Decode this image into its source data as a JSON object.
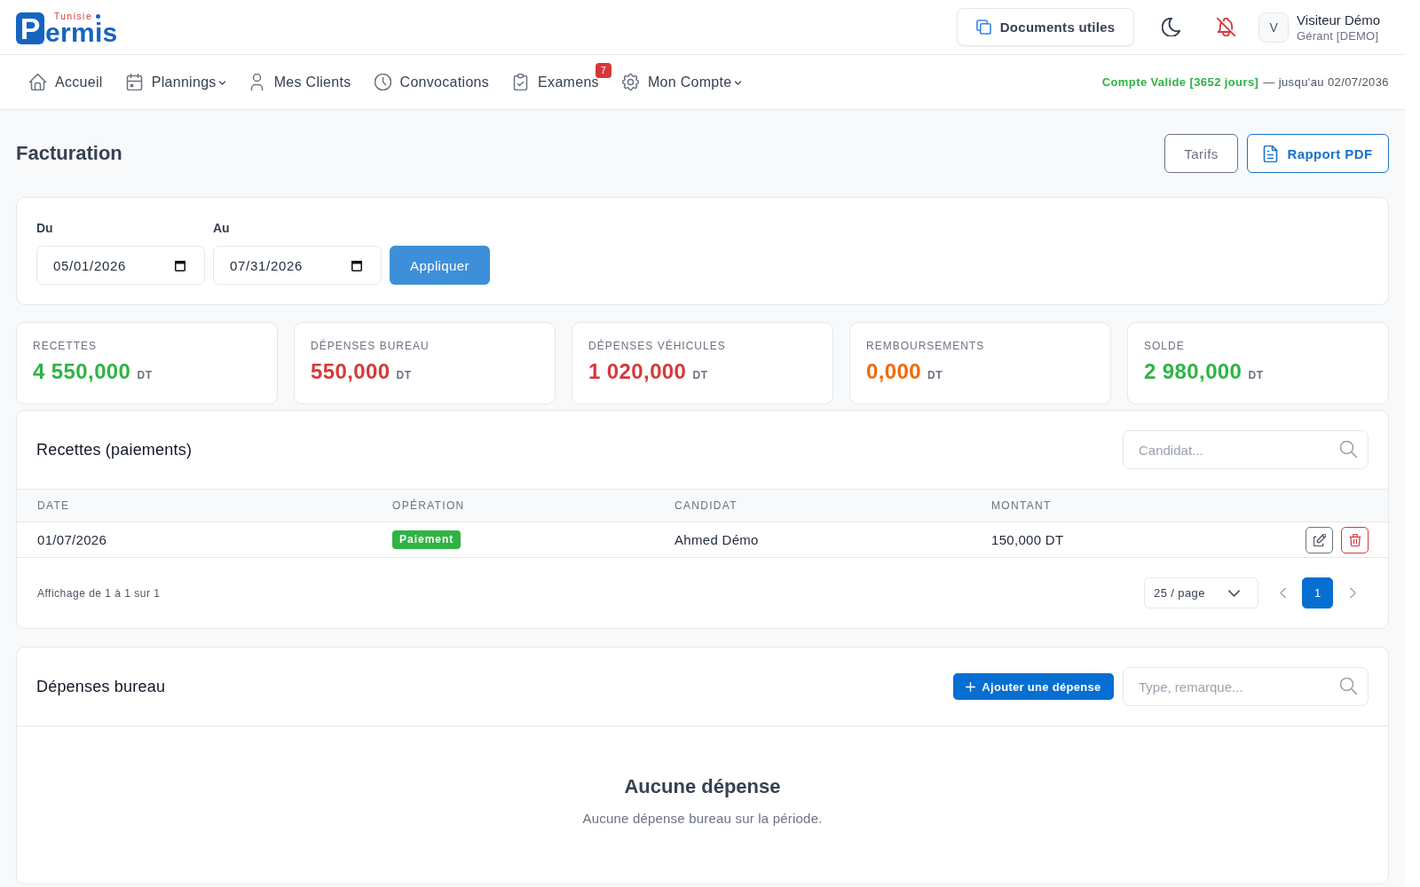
{
  "header": {
    "logo": {
      "tagline": "Tunisie",
      "letter": "P",
      "word": "ermis"
    },
    "documents_button": "Documents utiles",
    "notifications": {
      "muted": true
    },
    "user": {
      "initial": "V",
      "name": "Visiteur Démo",
      "role": "Gérant [DEMO]"
    }
  },
  "nav": {
    "items": [
      {
        "label": "Accueil",
        "dropdown": false
      },
      {
        "label": "Plannings",
        "dropdown": true
      },
      {
        "label": "Mes Clients",
        "dropdown": false
      },
      {
        "label": "Convocations",
        "dropdown": false
      },
      {
        "label": "Examens",
        "dropdown": false,
        "badge": "7"
      },
      {
        "label": "Mon Compte",
        "dropdown": true
      }
    ],
    "account": {
      "valid": true,
      "status": "Compte Valide [3652 jours]",
      "expiry": "— jusqu'au 02/07/2036"
    }
  },
  "page": {
    "title": "Facturation",
    "buttons": [
      {
        "label": "Tarifs",
        "kind": "secondary"
      },
      {
        "label": "Rapport PDF",
        "kind": "primary"
      }
    ]
  },
  "filter": {
    "fields": [
      {
        "label": "Du",
        "value": "05/01/2026"
      },
      {
        "label": "Au",
        "value": "07/31/2026"
      }
    ],
    "apply_button": "Appliquer"
  },
  "stats": [
    {
      "label": "RECETTES",
      "value": "4 550,000",
      "unit": "DT",
      "color": "#2fb344"
    },
    {
      "label": "DÉPENSES BUREAU",
      "value": "550,000",
      "unit": "DT",
      "color": "#d63939"
    },
    {
      "label": "DÉPENSES VÉHICULES",
      "value": "1 020,000",
      "unit": "DT",
      "color": "#d63939"
    },
    {
      "label": "REMBOURSEMENTS",
      "value": "0,000",
      "unit": "DT",
      "color": "#f76707"
    },
    {
      "label": "SOLDE",
      "value": "2 980,000",
      "unit": "DT",
      "color": "#2fb344"
    }
  ],
  "receipts": {
    "title": "Recettes (paiements)",
    "search": {
      "placeholder": "Candidat..."
    },
    "columns": [
      "DATE",
      "OPÉRATION",
      "CANDIDAT",
      "MONTANT"
    ],
    "rows": [
      {
        "date": "01/07/2026",
        "operation": "Paiement",
        "candidate": "Ahmed Démo",
        "amount": "150,000 DT"
      }
    ],
    "footer": {
      "summary": "Affichage de 1 à 1 sur 1",
      "page_size": "25 / page",
      "pages": [
        {
          "label": "1",
          "selected": true
        }
      ]
    }
  },
  "office_expenses": {
    "title": "Dépenses bureau",
    "add_button": "Ajouter une dépense",
    "search": {
      "placeholder": "Type, remarque..."
    },
    "empty": {
      "title": "Aucune dépense",
      "message": "Aucune dépense bureau sur la période."
    }
  }
}
